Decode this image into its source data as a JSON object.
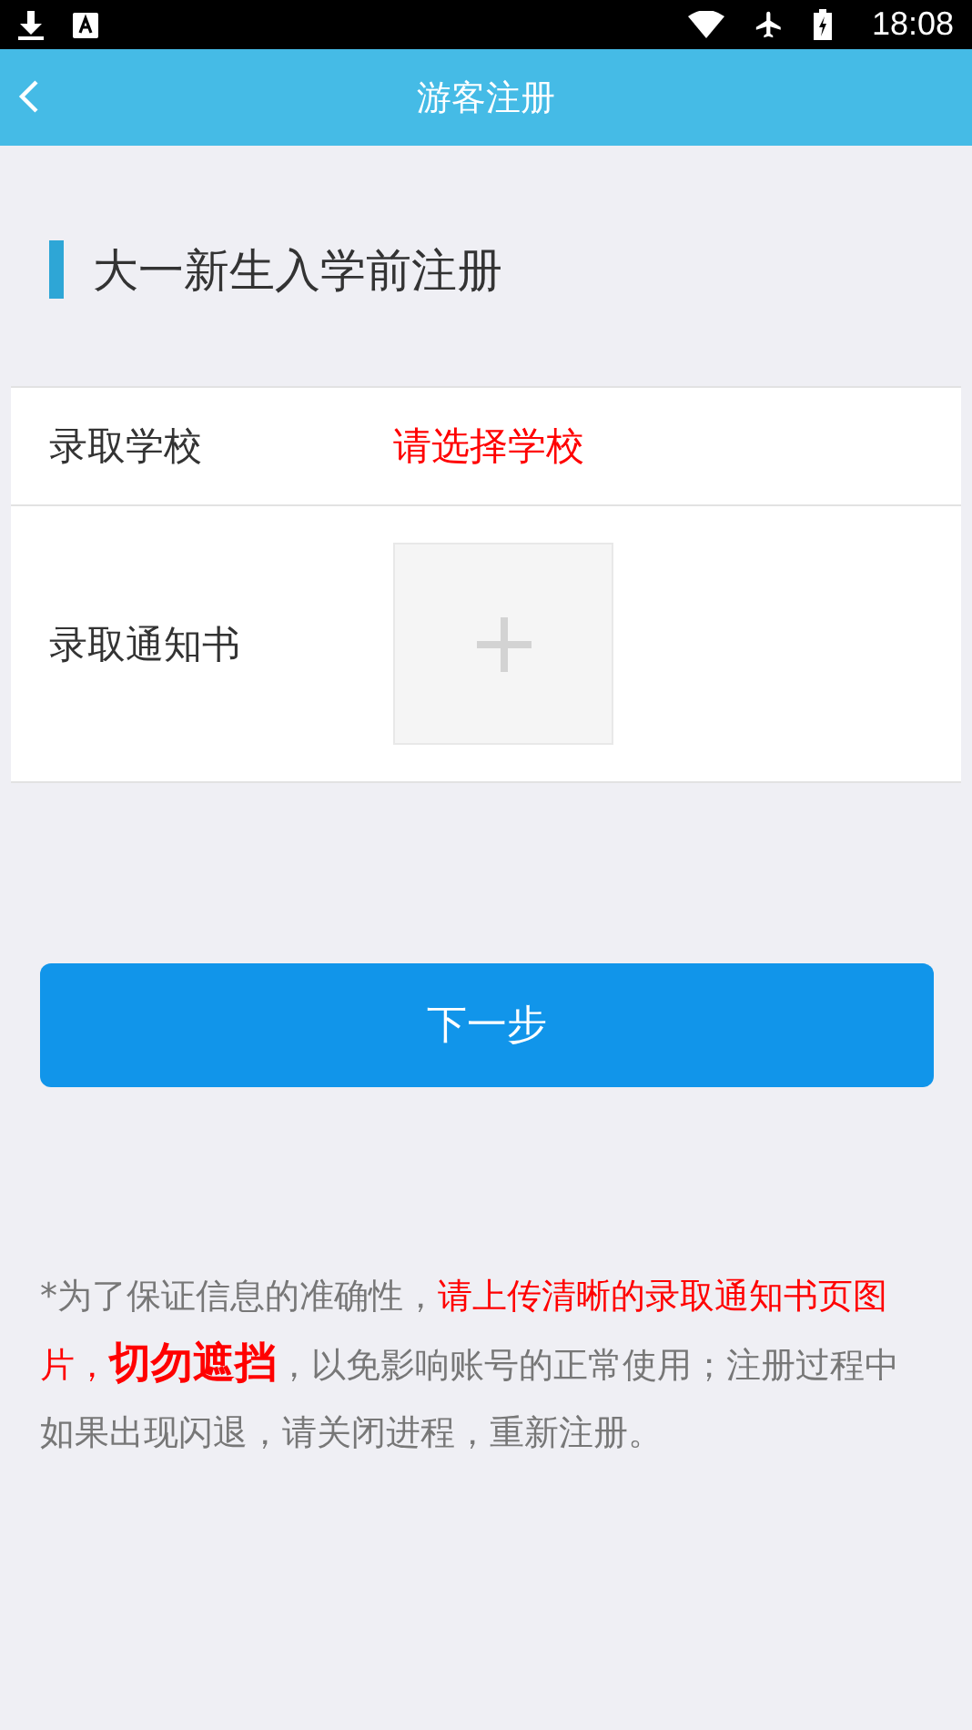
{
  "status_bar": {
    "time": "18:08"
  },
  "header": {
    "title": "游客注册"
  },
  "section": {
    "title": "大一新生入学前注册"
  },
  "form": {
    "rows": [
      {
        "kind": "select",
        "label": "录取学校",
        "placeholder": "请选择学校"
      },
      {
        "kind": "upload",
        "label": "录取通知书"
      }
    ]
  },
  "next_button": {
    "label": "下一步"
  },
  "note": [
    {
      "kind": "plain",
      "text": "*为了保证信息的准确性，"
    },
    {
      "kind": "highlight",
      "text": "请上传清晰的录取通知书页图片，"
    },
    {
      "kind": "strong",
      "text": "切勿遮挡"
    },
    {
      "kind": "plain",
      "text": "，以免影响账号的正常使用；注册过程中如果出现闪退，请关闭进程，重新注册。"
    }
  ]
}
